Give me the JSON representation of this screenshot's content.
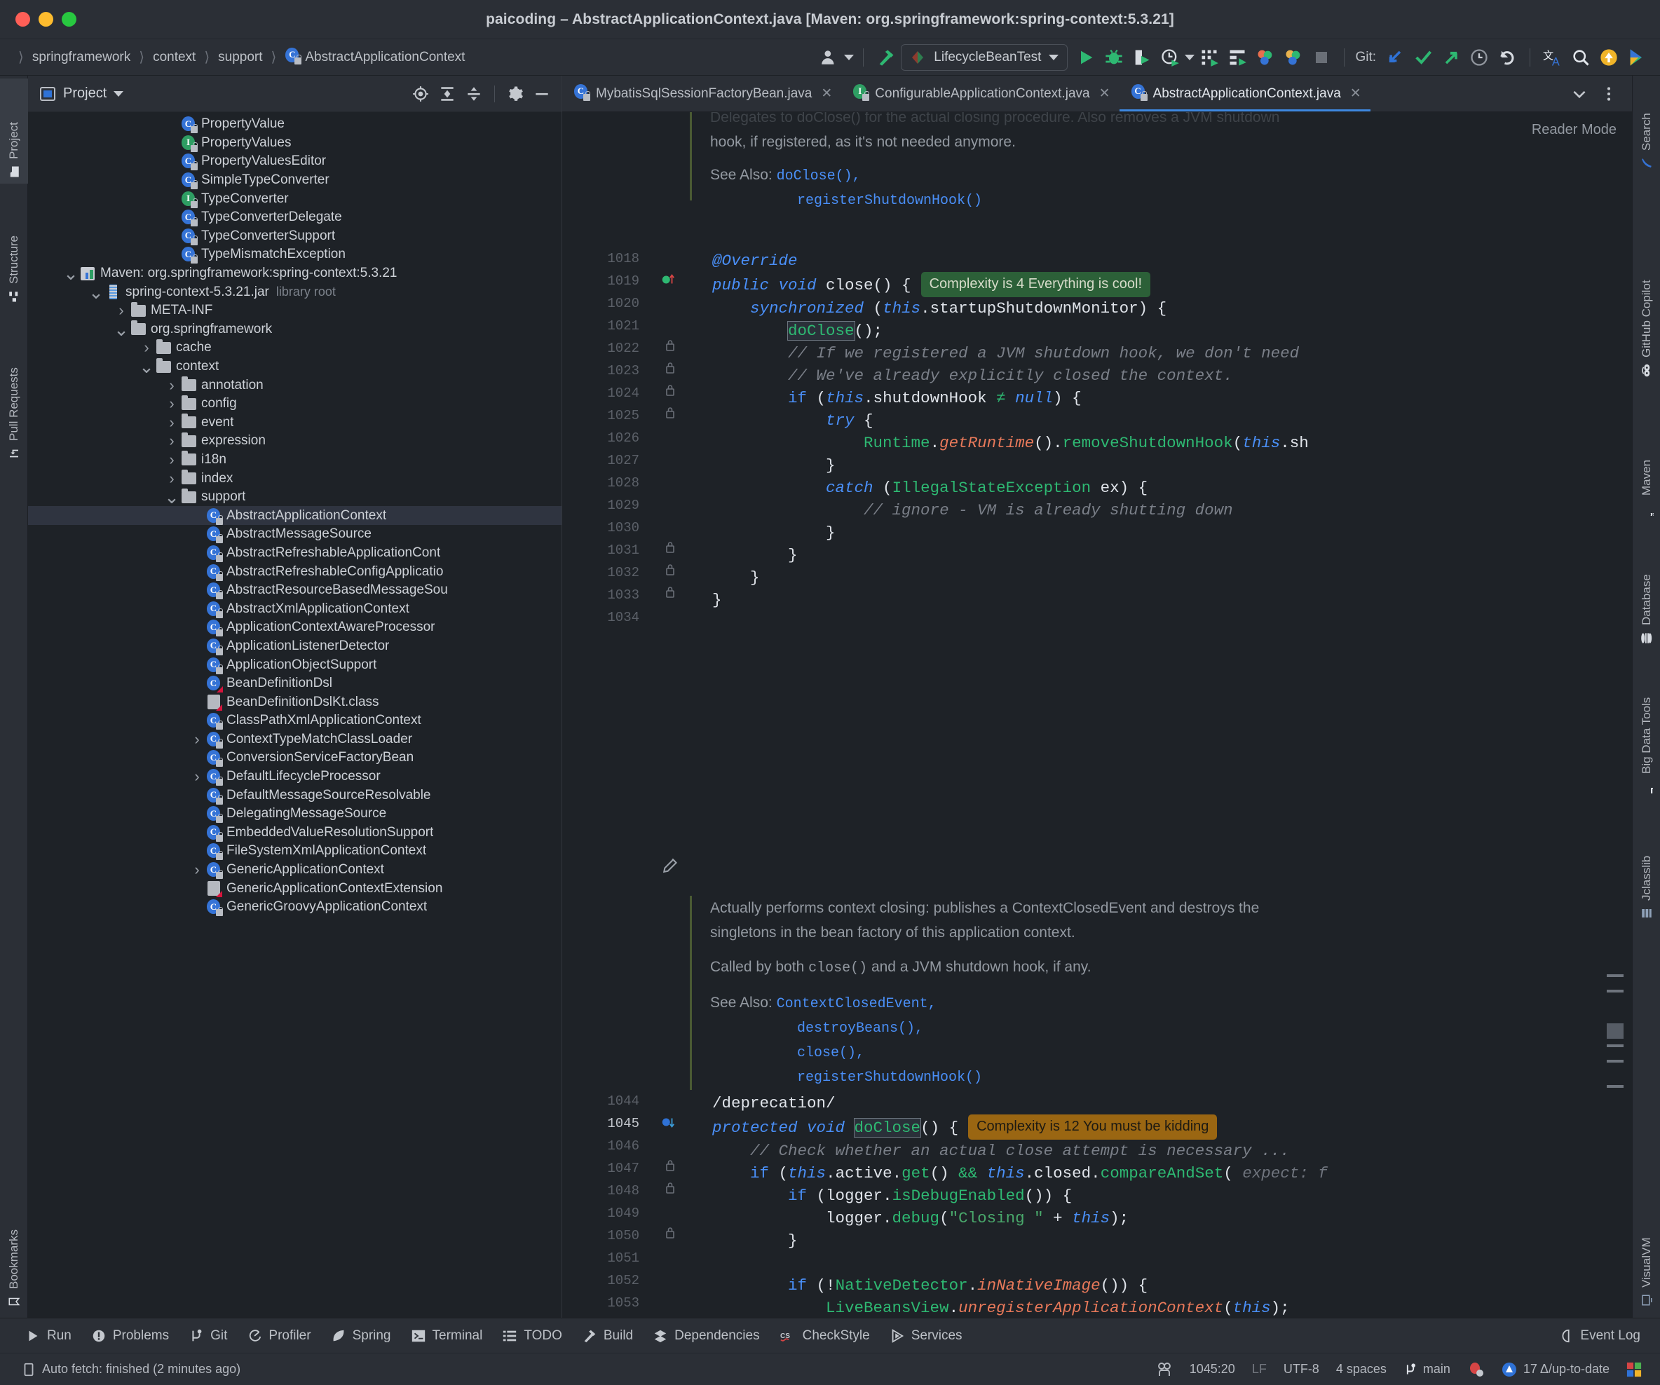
{
  "window": {
    "title": "paicoding – AbstractApplicationContext.java [Maven: org.springframework:spring-context:5.3.21]"
  },
  "breadcrumbs": [
    {
      "label": "springframework",
      "icon": "none"
    },
    {
      "label": "context",
      "icon": "none"
    },
    {
      "label": "support",
      "icon": "none"
    },
    {
      "label": "AbstractApplicationContext",
      "icon": "class-icon"
    }
  ],
  "toolbar": {
    "run_config": "LifecycleBeanTest",
    "git_label": "Git:",
    "icons": [
      "user-avatar-icon",
      "build-hammer-icon",
      "run-icon",
      "debug-icon",
      "run-with-coverage-icon",
      "profiler-icon",
      "more-run-icon",
      "services-grid-icon",
      "database-grid-icon",
      "plugins-icon",
      "plugins-alt-icon",
      "stop-icon",
      "update-project-icon",
      "commit-check-icon",
      "push-icon",
      "history-clock-icon",
      "rollback-icon",
      "translate-icon",
      "search-everywhere-icon",
      "notifications-icon",
      "ide-icon"
    ]
  },
  "left_stripe": [
    {
      "label": "Project",
      "icon": "project-folder-icon",
      "active": true
    },
    {
      "label": "Structure",
      "icon": "structure-icon",
      "active": false
    },
    {
      "label": "Pull Requests",
      "icon": "pull-request-icon",
      "active": false
    },
    {
      "label": "Bookmarks",
      "icon": "bookmark-icon",
      "active": false
    }
  ],
  "right_stripe": [
    {
      "label": "Search",
      "icon": "search-feather-icon"
    },
    {
      "label": "GitHub Copilot",
      "icon": "copilot-icon"
    },
    {
      "label": "Maven",
      "icon": "maven-m-icon"
    },
    {
      "label": "Database",
      "icon": "database-icon"
    },
    {
      "label": "Big Data Tools",
      "icon": "big-data-icon"
    },
    {
      "label": "Jclasslib",
      "icon": "jclasslib-icon"
    },
    {
      "label": "VisualVM",
      "icon": "visualvm-icon"
    }
  ],
  "project_panel": {
    "title": "Project",
    "header_icons": [
      "locate-file-icon",
      "expand-all-icon",
      "collapse-all-icon",
      "settings-gear-icon",
      "hide-minimize-icon"
    ],
    "tree": [
      {
        "indent": 5,
        "label": "PropertyValue",
        "icon": "class-icon",
        "arrow": "none"
      },
      {
        "indent": 5,
        "label": "PropertyValues",
        "icon": "interface-icon",
        "arrow": "none"
      },
      {
        "indent": 5,
        "label": "PropertyValuesEditor",
        "icon": "class-icon",
        "arrow": "none"
      },
      {
        "indent": 5,
        "label": "SimpleTypeConverter",
        "icon": "class-icon",
        "arrow": "none"
      },
      {
        "indent": 5,
        "label": "TypeConverter",
        "icon": "interface-icon",
        "arrow": "none"
      },
      {
        "indent": 5,
        "label": "TypeConverterDelegate",
        "icon": "class-icon",
        "arrow": "none"
      },
      {
        "indent": 5,
        "label": "TypeConverterSupport",
        "icon": "class-icon",
        "arrow": "none"
      },
      {
        "indent": 5,
        "label": "TypeMismatchException",
        "icon": "class-icon",
        "arrow": "none"
      },
      {
        "indent": 1,
        "label": "Maven: org.springframework:spring-context:5.3.21",
        "icon": "maven-lib-icon",
        "arrow": "down"
      },
      {
        "indent": 2,
        "label": "spring-context-5.3.21.jar",
        "dim": "library root",
        "icon": "jar-icon",
        "arrow": "down"
      },
      {
        "indent": 3,
        "label": "META-INF",
        "icon": "folder-icon",
        "arrow": "right"
      },
      {
        "indent": 3,
        "label": "org.springframework",
        "icon": "folder-icon",
        "arrow": "down"
      },
      {
        "indent": 4,
        "label": "cache",
        "icon": "folder-icon",
        "arrow": "right"
      },
      {
        "indent": 4,
        "label": "context",
        "icon": "folder-icon",
        "arrow": "down"
      },
      {
        "indent": 5,
        "label": "annotation",
        "icon": "folder-icon",
        "arrow": "right"
      },
      {
        "indent": 5,
        "label": "config",
        "icon": "folder-icon",
        "arrow": "right"
      },
      {
        "indent": 5,
        "label": "event",
        "icon": "folder-icon",
        "arrow": "right"
      },
      {
        "indent": 5,
        "label": "expression",
        "icon": "folder-icon",
        "arrow": "right"
      },
      {
        "indent": 5,
        "label": "i18n",
        "icon": "folder-icon",
        "arrow": "right"
      },
      {
        "indent": 5,
        "label": "index",
        "icon": "folder-icon",
        "arrow": "right"
      },
      {
        "indent": 5,
        "label": "support",
        "icon": "folder-icon",
        "arrow": "down"
      },
      {
        "indent": 6,
        "label": "AbstractApplicationContext",
        "icon": "class-icon",
        "arrow": "none",
        "selected": true
      },
      {
        "indent": 6,
        "label": "AbstractMessageSource",
        "icon": "class-icon",
        "arrow": "none"
      },
      {
        "indent": 6,
        "label": "AbstractRefreshableApplicationCont",
        "icon": "class-icon",
        "arrow": "none"
      },
      {
        "indent": 6,
        "label": "AbstractRefreshableConfigApplicatio",
        "icon": "class-icon",
        "arrow": "none"
      },
      {
        "indent": 6,
        "label": "AbstractResourceBasedMessageSou",
        "icon": "class-icon",
        "arrow": "none"
      },
      {
        "indent": 6,
        "label": "AbstractXmlApplicationContext",
        "icon": "class-icon",
        "arrow": "none"
      },
      {
        "indent": 6,
        "label": "ApplicationContextAwareProcessor",
        "icon": "class-icon",
        "arrow": "none"
      },
      {
        "indent": 6,
        "label": "ApplicationListenerDetector",
        "icon": "class-icon",
        "arrow": "none"
      },
      {
        "indent": 6,
        "label": "ApplicationObjectSupport",
        "icon": "class-icon",
        "arrow": "none"
      },
      {
        "indent": 6,
        "label": "BeanDefinitionDsl",
        "icon": "kotlin-class-icon",
        "arrow": "none"
      },
      {
        "indent": 6,
        "label": "BeanDefinitionDslKt.class",
        "icon": "kotlin-file-icon",
        "arrow": "none"
      },
      {
        "indent": 6,
        "label": "ClassPathXmlApplicationContext",
        "icon": "class-icon",
        "arrow": "none"
      },
      {
        "indent": 6,
        "label": "ContextTypeMatchClassLoader",
        "icon": "class-icon",
        "arrow": "right"
      },
      {
        "indent": 6,
        "label": "ConversionServiceFactoryBean",
        "icon": "class-icon",
        "arrow": "none"
      },
      {
        "indent": 6,
        "label": "DefaultLifecycleProcessor",
        "icon": "class-icon",
        "arrow": "right"
      },
      {
        "indent": 6,
        "label": "DefaultMessageSourceResolvable",
        "icon": "class-icon",
        "arrow": "none"
      },
      {
        "indent": 6,
        "label": "DelegatingMessageSource",
        "icon": "class-icon",
        "arrow": "none"
      },
      {
        "indent": 6,
        "label": "EmbeddedValueResolutionSupport",
        "icon": "class-icon",
        "arrow": "none"
      },
      {
        "indent": 6,
        "label": "FileSystemXmlApplicationContext",
        "icon": "class-icon",
        "arrow": "none"
      },
      {
        "indent": 6,
        "label": "GenericApplicationContext",
        "icon": "class-icon",
        "arrow": "right"
      },
      {
        "indent": 6,
        "label": "GenericApplicationContextExtension",
        "icon": "kotlin-file-icon",
        "arrow": "none"
      },
      {
        "indent": 6,
        "label": "GenericGroovyApplicationContext",
        "icon": "class-icon",
        "arrow": "none"
      }
    ]
  },
  "editor": {
    "tabs": [
      {
        "label": "MybatisSqlSessionFactoryBean.java",
        "icon": "class-icon",
        "active": false
      },
      {
        "label": "ConfigurableApplicationContext.java",
        "icon": "interface-icon",
        "active": false
      },
      {
        "label": "AbstractApplicationContext.java",
        "icon": "class-icon",
        "active": true
      }
    ],
    "tab_overflow_icon": "chevron-down-icon",
    "tab_more_icon": "more-vertical-icon",
    "reader_mode_label": "Reader Mode",
    "doc_top": {
      "line1": "Delegates to doClose() for the actual closing procedure. Also removes a JVM shutdown",
      "line2": "hook, if registered, as it's not needed anymore.",
      "see_also_label": "See Also:",
      "see_also": [
        "doClose(),",
        "registerShutdownHook()"
      ]
    },
    "doc_bottom": {
      "p1_line1": "Actually performs context closing: publishes a ContextClosedEvent and destroys the",
      "p1_line2": "singletons in the bean factory of this application context.",
      "p2_pre": "Called by both ",
      "p2_mono": "close()",
      "p2_post": " and a JVM shutdown hook, if any.",
      "see_also_label": "See Also:",
      "see_also": [
        "ContextClosedEvent,",
        "destroyBeans(),",
        "close(),",
        "registerShutdownHook()"
      ]
    },
    "inlay_hints": [
      {
        "text": "Complexity is 4 Everything is cool!",
        "style": "ok"
      },
      {
        "text": "Complexity is 12 You must be kidding",
        "style": "warn"
      }
    ],
    "line_numbers_top": [
      "1018",
      "1019",
      "1020",
      "1021",
      "1022",
      "1023",
      "1024",
      "1025",
      "1026",
      "1027",
      "1028",
      "1029",
      "1030",
      "1031",
      "1032",
      "1033",
      "1034"
    ],
    "line_numbers_bottom": [
      "1044",
      "1045",
      "1046",
      "1047",
      "1048",
      "1049",
      "1050",
      "1051",
      "1052",
      "1053"
    ],
    "current_line": "1045",
    "code_top": [
      "@Override",
      "public void close() {",
      "    synchronized (this.startupShutdownMonitor) {",
      "        doClose();",
      "        // If we registered a JVM shutdown hook, we don't need",
      "        // We've already explicitly closed the context.",
      "        if (this.shutdownHook ≠ null) {",
      "            try {",
      "                Runtime.getRuntime().removeShutdownHook(this.sh",
      "            }",
      "            catch (IllegalStateException ex) {",
      "                // ignore - VM is already shutting down",
      "            }",
      "        }",
      "    }",
      "}",
      ""
    ],
    "code_bottom": [
      "/deprecation/",
      "protected void doClose() {",
      "    // Check whether an actual close attempt is necessary ...",
      "    if (this.active.get() && this.closed.compareAndSet( expect: f",
      "        if (logger.isDebugEnabled()) {",
      "            logger.debug(\"Closing \" + this);",
      "        }",
      "",
      "        if (!NativeDetector.inNativeImage()) {",
      "            LiveBeansView.unregisterApplicationContext(this);"
    ]
  },
  "tool_window_bar": [
    {
      "label": "Run",
      "icon": "run-icon"
    },
    {
      "label": "Problems",
      "icon": "problems-icon"
    },
    {
      "label": "Git",
      "icon": "git-branch-icon"
    },
    {
      "label": "Profiler",
      "icon": "profiler-icon"
    },
    {
      "label": "Spring",
      "icon": "spring-leaf-icon"
    },
    {
      "label": "Terminal",
      "icon": "terminal-icon"
    },
    {
      "label": "TODO",
      "icon": "todo-list-icon"
    },
    {
      "label": "Build",
      "icon": "build-hammer-icon"
    },
    {
      "label": "Dependencies",
      "icon": "dependencies-icon"
    },
    {
      "label": "CheckStyle",
      "icon": "checkstyle-icon"
    },
    {
      "label": "Services",
      "icon": "services-icon"
    },
    {
      "label": "Event Log",
      "icon": "event-log-icon"
    }
  ],
  "status_bar": {
    "message": "Auto fetch: finished (2 minutes ago)",
    "message_icon": "memory-indicator-icon",
    "caret_position": "1045:20",
    "line_separator": "LF",
    "encoding": "UTF-8",
    "indent": "4 spaces",
    "branch": "main",
    "branch_icon": "git-branch-icon",
    "inspections_icon": "inspection-bug-icon",
    "analysis": "17 Δ/up-to-date",
    "analysis_icon": "analysis-triangle-icon",
    "ide_badge_icon": "ide-color-badge-icon"
  },
  "colors": {
    "accent_blue": "#3e88e0",
    "green": "#2eb872",
    "inlay_ok_bg": "#2c6038",
    "inlay_warn_bg": "#9a6612",
    "editor_bg": "#1e2227",
    "panel_bg": "#2b2f36"
  }
}
